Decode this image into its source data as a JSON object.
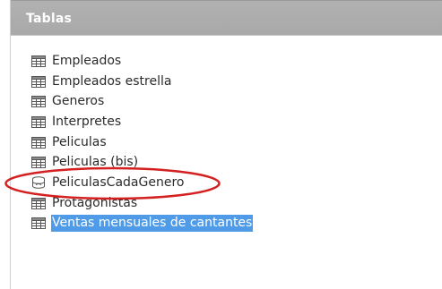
{
  "panel": {
    "title": "Tablas"
  },
  "tree": {
    "items": [
      {
        "label": "Empleados",
        "icon": "table-icon",
        "selected": false
      },
      {
        "label": "Empleados estrella",
        "icon": "table-icon",
        "selected": false
      },
      {
        "label": "Generos",
        "icon": "table-icon",
        "selected": false
      },
      {
        "label": "Interpretes",
        "icon": "table-icon",
        "selected": false
      },
      {
        "label": "Peliculas",
        "icon": "table-icon",
        "selected": false
      },
      {
        "label": "Peliculas (bis)",
        "icon": "table-icon",
        "selected": false
      },
      {
        "label": "PeliculasCadaGenero",
        "icon": "query-icon",
        "selected": false
      },
      {
        "label": "Protagonistas",
        "icon": "table-icon",
        "selected": false
      },
      {
        "label": "Ventas mensuales de cantantes",
        "icon": "table-icon",
        "selected": true
      }
    ]
  },
  "colors": {
    "header_bg": "#ababab",
    "selection_bg": "#4f9be8",
    "annotation": "#d42020"
  }
}
